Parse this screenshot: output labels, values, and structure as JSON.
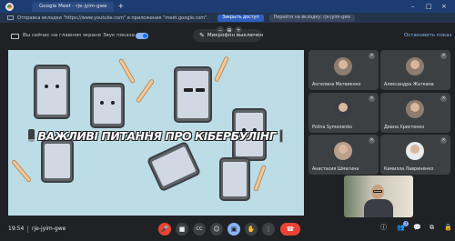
{
  "browser": {
    "tab_title": "Google Meet - rje-jyim-gwe",
    "new_tab_symbol": "+",
    "minimize": "–",
    "maximize": "□",
    "close": "×"
  },
  "share_bar": {
    "message": "Отправка вкладки \"https://www.youtube.com\" в приложение \"meet.google.com\".",
    "stop_button": "Закрыть доступ",
    "back_button": "Перейти на вкладку: rje-jyim-gwe"
  },
  "meet_header": {
    "presenting_label": "Вы сейчас на главном экране",
    "sound_label": "Звук показа",
    "sound_on": true,
    "mic_status": "Микрофон выключен",
    "stop_presenting": "Остановить показ",
    "zoom_out": "−",
    "zoom_reset": "⊕",
    "zoom_in": "+"
  },
  "presentation": {
    "title": "ВАЖЛИВІ ПИТАННЯ ПРО КІБЕРБУЛІНГ",
    "background": "#bcdde6"
  },
  "participants": [
    {
      "name": "Ангелина Матвиенко",
      "muted_icon": "mic-off"
    },
    {
      "name": "Александра Жаткина",
      "muted_icon": "mic-off"
    },
    {
      "name": "Polina Symonenko",
      "muted_icon": "mic-off"
    },
    {
      "name": "Диана Христенко",
      "muted_icon": "mic-off"
    },
    {
      "name": "Анастасия Шмагина",
      "muted_icon": "mic-off"
    },
    {
      "name": "Камилла Лавриненко",
      "muted_icon": "mic-off"
    }
  ],
  "bottom_bar": {
    "time": "19:54",
    "meeting_code": "rje-jyim-gwe",
    "mic_glyph": "🎤",
    "cam_glyph": "■",
    "cc_glyph": "CC",
    "emoji_glyph": "☺",
    "present_glyph": "▣",
    "hand_glyph": "✋",
    "more_glyph": "⋮",
    "hangup_glyph": "☎",
    "info_glyph": "ⓘ",
    "people_glyph": "👥",
    "people_count": "7",
    "chat_glyph": "💬",
    "activities_glyph": "⧉",
    "lock_glyph": "🔒"
  },
  "colors": {
    "accent": "#8ab4f8",
    "danger": "#ea4335",
    "surface": "#3c4043",
    "background": "#202124"
  }
}
